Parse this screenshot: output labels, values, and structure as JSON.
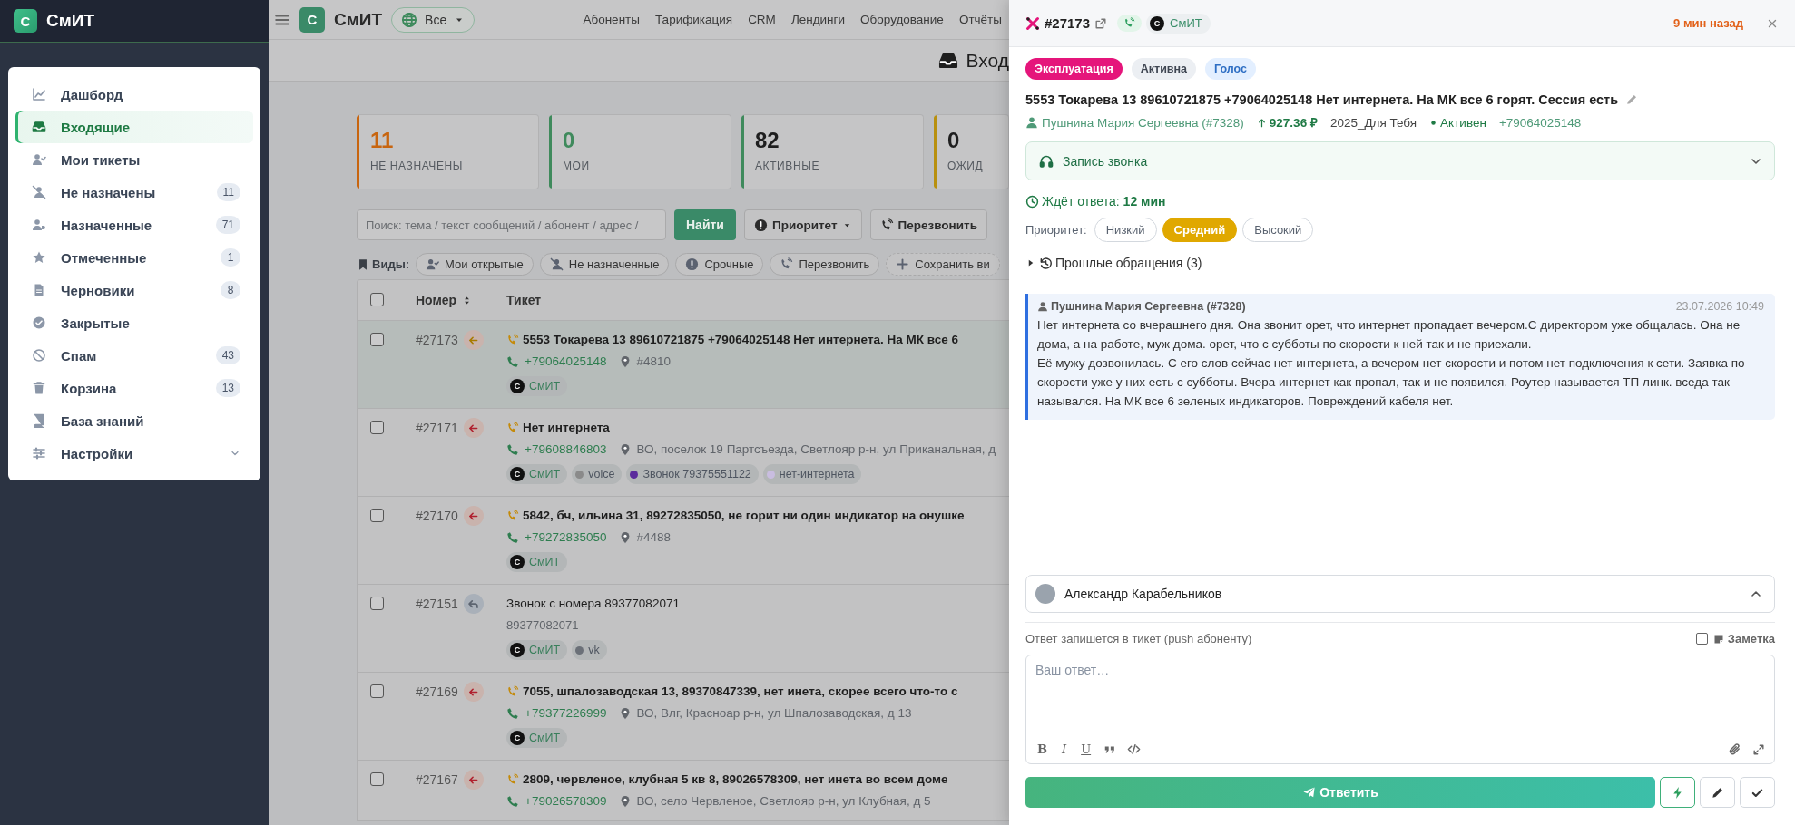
{
  "sidebar": {
    "brand": {
      "logo_letter": "С",
      "name": "СмИТ"
    },
    "items": [
      {
        "label": "Дашборд",
        "selected": false,
        "kind": "link"
      },
      {
        "label": "Входящие",
        "selected": true,
        "kind": "link"
      },
      {
        "label": "Мои тикеты",
        "selected": false,
        "kind": "link"
      },
      {
        "label": "Не назначены",
        "badge": "11",
        "selected": false,
        "kind": "link"
      },
      {
        "label": "Назначенные",
        "badge": "71",
        "selected": false,
        "kind": "link"
      },
      {
        "label": "Отмеченные",
        "badge": "1",
        "selected": false,
        "kind": "link"
      },
      {
        "label": "Черновики",
        "badge": "8",
        "selected": false,
        "kind": "link"
      },
      {
        "label": "Закрытые",
        "selected": false,
        "kind": "link"
      },
      {
        "label": "Спам",
        "badge": "43",
        "selected": false,
        "kind": "link"
      },
      {
        "label": "Корзина",
        "badge": "13",
        "selected": false,
        "kind": "link"
      },
      {
        "label": "База знаний",
        "selected": false,
        "kind": "link"
      },
      {
        "label": "Настройки",
        "selected": false,
        "kind": "group"
      }
    ]
  },
  "topbar": {
    "brand": {
      "logo_letter": "С",
      "name": "СмИТ"
    },
    "scope": "Все",
    "nav": [
      "Абоненты",
      "Тарификация",
      "CRM",
      "Лендинги",
      "Оборудование",
      "Отчёты"
    ]
  },
  "page_title": "Вход",
  "stats": [
    {
      "value": "11",
      "label": "НЕ НАЗНАЧЕНЫ",
      "color": "#c8650f",
      "emphasis": true
    },
    {
      "value": "0",
      "label": "МОИ",
      "color": "#3f8a5c",
      "emphasis": true
    },
    {
      "value": "82",
      "label": "АКТИВНЫЕ",
      "color": "#3f8a5c",
      "emphasis": false
    },
    {
      "value": "0",
      "label": "ОЖИД",
      "color": "#b8900f",
      "emphasis": false
    }
  ],
  "search": {
    "placeholder": "Поиск: тема / текст сообщений / абонент / адрес /",
    "button": "Найти",
    "filters": [
      "Приоритет",
      "Перезвонить"
    ]
  },
  "views": {
    "label": "Виды:",
    "items": [
      "Мои открытые",
      "Не назначенные",
      "Срочные",
      "Перезвонить",
      "Сохранить ви"
    ]
  },
  "table": {
    "columns": [
      "Номер",
      "Тикет"
    ],
    "header_checked": false,
    "rows": [
      {
        "number": "#27173",
        "selected": true,
        "checked": false,
        "direction": {
          "kind": "incoming",
          "color": "#a77a00"
        },
        "unread": true,
        "subject": "5553 Токарева 13 89610721875 +79064025148 Нет интернета. На МК все 6",
        "phone": "+79064025148",
        "location": "#4810",
        "tags": [
          {
            "kind": "brand",
            "logo_letter": "С",
            "label": "СмИТ"
          }
        ]
      },
      {
        "number": "#27171",
        "selected": false,
        "checked": false,
        "direction": {
          "kind": "incoming",
          "color": "#b0202e"
        },
        "unread": true,
        "subject": "Нет интернета",
        "phone": "+79608846803",
        "location": "ВО, поселок 19 Партсъезда, Светлояр р-н, ул Приканальная, д",
        "tags": [
          {
            "kind": "brand",
            "logo_letter": "С",
            "label": "СмИТ"
          },
          {
            "kind": "dot",
            "label": "voice",
            "color": "#8a8a8a"
          },
          {
            "kind": "dot",
            "label": "Звонок 79375551122",
            "color": "#5b2a9c"
          },
          {
            "kind": "dot",
            "label": "нет-интернета",
            "color": "#c9bde0"
          }
        ]
      },
      {
        "number": "#27170",
        "selected": false,
        "checked": false,
        "direction": {
          "kind": "incoming",
          "color": "#b0202e"
        },
        "unread": true,
        "subject": "5842, бч, ильина 31, 89272835050, не горит ни один индикатор на онушке",
        "phone": "+79272835050",
        "location": "#4488",
        "tags": [
          {
            "kind": "brand",
            "logo_letter": "С",
            "label": "СмИТ"
          }
        ]
      },
      {
        "number": "#27151",
        "selected": false,
        "checked": false,
        "direction": {
          "kind": "reply",
          "color": "#5c6470"
        },
        "unread": false,
        "subject": "Звонок с номера 89377082071",
        "caller": "89377082071",
        "tags": [
          {
            "kind": "brand",
            "logo_letter": "С",
            "label": "СмИТ"
          },
          {
            "kind": "dot",
            "label": "vk",
            "color": "#6b7078"
          }
        ]
      },
      {
        "number": "#27169",
        "selected": false,
        "checked": false,
        "direction": {
          "kind": "incoming",
          "color": "#b0202e"
        },
        "unread": true,
        "subject": "7055, шпалозаводская 13, 89370847339, нет инета, скорее всего что-то с",
        "phone": "+79377226999",
        "location": "ВО, Влг, Красноар р-н, ул Шпалозаводская, д 13",
        "tags": [
          {
            "kind": "brand",
            "logo_letter": "С",
            "label": "СмИТ"
          }
        ]
      },
      {
        "number": "#27167",
        "selected": false,
        "checked": false,
        "direction": {
          "kind": "incoming",
          "color": "#b0202e"
        },
        "unread": true,
        "subject": "2809, червленое, клубная 5 кв 8, 89026578309, нет инета во всем доме",
        "phone": "+79026578309",
        "location": "ВО, село Червленое, Светлояр р-н, ул Клубная, д 5",
        "tags": []
      }
    ]
  },
  "ticket_panel": {
    "number": "#27173",
    "brand": {
      "logo_letter": "С",
      "name": "СмИТ"
    },
    "time": "9 мин назад",
    "badges": [
      {
        "label": "Эксплуатация",
        "kind": "category"
      },
      {
        "label": "Активна",
        "kind": "status"
      },
      {
        "label": "Голос",
        "kind": "channel"
      }
    ],
    "subject": "5553 Токарева 13 89610721875 +79064025148 Нет интернета. На МК все 6 горят. Сессия есть",
    "subscriber": {
      "name": "Пушнина Мария Сергеевна (#7328)",
      "balance": "927.36 ₽",
      "tariff": "2025_Для Тебя",
      "status": "Активен",
      "phone": "+79064025148"
    },
    "recording": {
      "label": "Запись звонка",
      "expanded": false
    },
    "waiting": {
      "label": "Ждёт ответа:",
      "value": "12 мин"
    },
    "priority": {
      "label": "Приоритет:",
      "options": [
        {
          "label": "Низкий",
          "selected": false
        },
        {
          "label": "Средний",
          "selected": true
        },
        {
          "label": "Высокий",
          "selected": false
        }
      ]
    },
    "history": {
      "label": "Прошлые обращения (3)",
      "expanded": false
    },
    "messages": [
      {
        "author": "Пушнина Мария Сергеевна (#7328)",
        "time": "23.07.2026 10:49",
        "paragraphs": [
          "Нет интернета со вчерашнего дня. Она звонит орет, что интернет пропадает вечером.С директором уже общалась. Она не дома, а на работе, муж дома. орет, что с субботы по скорости к ней так и не приехали.",
          "Её мужу дозвонилась. С его слов сейчас нет интернета, а вечером нет скорости и потом нет подключения к сети. Заявка по скорости уже у них есть с субботы. Вчера интернет как пропал, так и не появился. Роутер называется ТП линк. вседа так назывался. На МК все 6 зеленых индикаторов. Повреждений кабеля нет."
        ]
      }
    ],
    "assignee": {
      "name": "Александр Карабельников",
      "expanded": true
    },
    "reply": {
      "hint": "Ответ запишется в тикет (push абоненту)",
      "note": {
        "label": "Заметка",
        "checked": false
      },
      "placeholder": "Ваш ответ…",
      "format_buttons": [
        "B",
        "I",
        "U"
      ],
      "send": "Ответить"
    }
  }
}
